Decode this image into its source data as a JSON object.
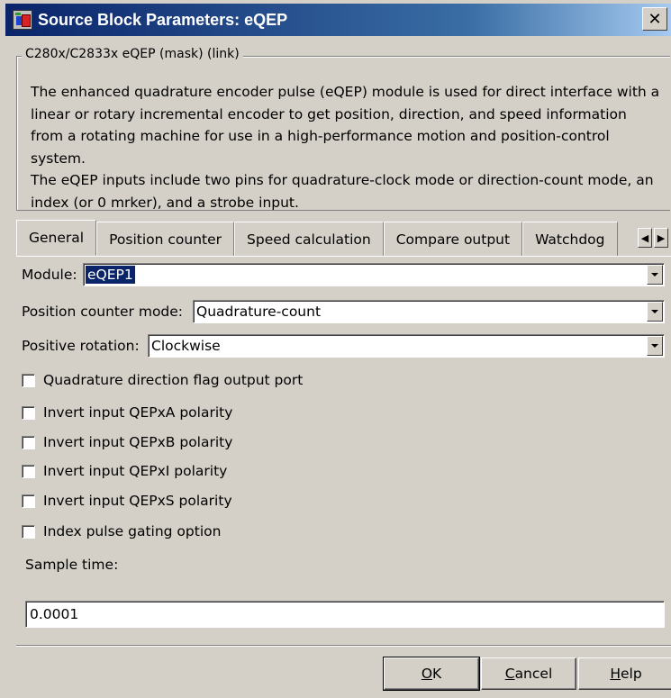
{
  "window": {
    "title": "Source Block Parameters: eQEP",
    "close_symbol": "✕"
  },
  "group": {
    "legend": "C280x/C2833x eQEP (mask) (link)",
    "description_1": "The enhanced quadrature encoder pulse (eQEP) module is used for direct interface with a linear or rotary incremental encoder to get position, direction, and speed information from a rotating machine for use in a high-performance motion and position-control system.",
    "description_2": "The eQEP inputs include two pins for quadrature-clock mode or direction-count mode, an index (or 0 mrker), and a strobe input."
  },
  "tabs": [
    "General",
    "Position counter",
    "Speed calculation",
    "Compare output",
    "Watchdog"
  ],
  "active_tab": "General",
  "form": {
    "module_label": "Module:",
    "module_value": "eQEP1",
    "position_mode_label": "Position counter mode:",
    "position_mode_value": "Quadrature-count",
    "rotation_label": "Positive rotation:",
    "rotation_value": "Clockwise",
    "checkboxes": [
      {
        "label": "Quadrature direction flag output port",
        "checked": false
      },
      {
        "label": "Invert input QEPxA polarity",
        "checked": false
      },
      {
        "label": "Invert input QEPxB polarity",
        "checked": false
      },
      {
        "label": "Invert input QEPxI polarity",
        "checked": false
      },
      {
        "label": "Invert input QEPxS polarity",
        "checked": false
      },
      {
        "label": "Index pulse gating option",
        "checked": false
      }
    ],
    "sample_time_label": "Sample time:",
    "sample_time_value": "0.0001"
  },
  "buttons": {
    "ok": {
      "mnemonic": "O",
      "rest": "K"
    },
    "cancel": {
      "mnemonic": "C",
      "rest": "ancel"
    },
    "help": {
      "mnemonic": "H",
      "rest": "elp"
    }
  }
}
